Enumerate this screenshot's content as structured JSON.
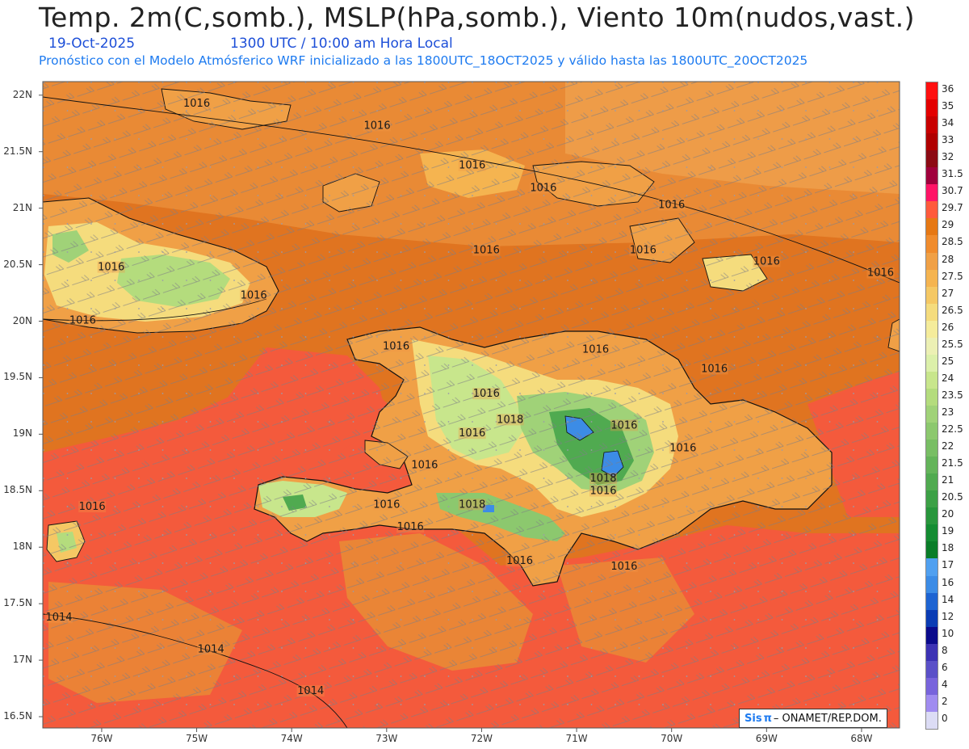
{
  "header": {
    "title": "Temp. 2m(C,somb.), MSLP(hPa,somb.), Viento 10m(nudos,vast.)",
    "date": "19-Oct-2025",
    "time": "1300 UTC / 10:00 am Hora Local",
    "model_info": "Pronóstico con el Modelo Atmósferico WRF inicializado a las 1800UTC_18OCT2025 y válido hasta las  1800UTC_20OCT2025"
  },
  "map": {
    "lat_labels": [
      "22N",
      "21.5N",
      "21N",
      "20.5N",
      "20N",
      "19.5N",
      "19N",
      "18.5N",
      "18N",
      "17.5N",
      "17N",
      "16.5N"
    ],
    "lon_labels": [
      "76W",
      "75W",
      "74W",
      "73W",
      "72W",
      "71W",
      "70W",
      "69W",
      "68W"
    ],
    "lat_values": [
      22,
      21.5,
      21,
      20.5,
      20,
      19.5,
      19,
      18.5,
      18,
      17.5,
      17,
      16.5
    ],
    "lon_values": [
      -76,
      -75,
      -74,
      -73,
      -72,
      -71,
      -70,
      -69,
      -68
    ],
    "isobars": [
      {
        "label": "1016",
        "lon": -75.0,
        "lat": 21.9
      },
      {
        "label": "1016",
        "lon": -73.1,
        "lat": 21.7
      },
      {
        "label": "1016",
        "lon": -72.1,
        "lat": 21.35
      },
      {
        "label": "1016",
        "lon": -71.35,
        "lat": 21.15
      },
      {
        "label": "1016",
        "lon": -70.0,
        "lat": 21.0
      },
      {
        "label": "1016",
        "lon": -70.3,
        "lat": 20.6
      },
      {
        "label": "1016",
        "lon": -71.95,
        "lat": 20.6
      },
      {
        "label": "1016",
        "lon": -69.0,
        "lat": 20.5
      },
      {
        "label": "1016",
        "lon": -67.8,
        "lat": 20.4
      },
      {
        "label": "1016",
        "lon": -75.9,
        "lat": 20.45
      },
      {
        "label": "1016",
        "lon": -74.4,
        "lat": 20.2
      },
      {
        "label": "1016",
        "lon": -76.2,
        "lat": 19.98
      },
      {
        "label": "1016",
        "lon": -72.9,
        "lat": 19.75
      },
      {
        "label": "1016",
        "lon": -70.8,
        "lat": 19.72
      },
      {
        "label": "1016",
        "lon": -69.55,
        "lat": 19.55
      },
      {
        "label": "1016",
        "lon": -71.95,
        "lat": 19.33
      },
      {
        "label": "1018",
        "lon": -71.7,
        "lat": 19.1
      },
      {
        "label": "1016",
        "lon": -72.1,
        "lat": 18.98
      },
      {
        "label": "1016",
        "lon": -70.5,
        "lat": 19.05
      },
      {
        "label": "1016",
        "lon": -69.88,
        "lat": 18.85
      },
      {
        "label": "1016",
        "lon": -72.6,
        "lat": 18.7
      },
      {
        "label": "1018",
        "lon": -70.72,
        "lat": 18.58
      },
      {
        "label": "1016",
        "lon": -70.72,
        "lat": 18.47
      },
      {
        "label": "1016",
        "lon": -76.1,
        "lat": 18.33
      },
      {
        "label": "1016",
        "lon": -73.0,
        "lat": 18.35
      },
      {
        "label": "1018",
        "lon": -72.1,
        "lat": 18.35
      },
      {
        "label": "1016",
        "lon": -72.75,
        "lat": 18.15
      },
      {
        "label": "1016",
        "lon": -71.6,
        "lat": 17.85
      },
      {
        "label": "1016",
        "lon": -70.5,
        "lat": 17.8
      },
      {
        "label": "1014",
        "lon": -76.45,
        "lat": 17.35
      },
      {
        "label": "1014",
        "lon": -74.85,
        "lat": 17.07
      },
      {
        "label": "1014",
        "lon": -73.8,
        "lat": 16.7
      }
    ]
  },
  "colorbar": {
    "labels": [
      "36",
      "35",
      "34",
      "33",
      "32",
      "31.5",
      "30.7",
      "29.7",
      "29",
      "28.5",
      "28",
      "27.5",
      "27",
      "26.5",
      "26",
      "25.5",
      "25",
      "24",
      "23.5",
      "23",
      "22.5",
      "22",
      "21.5",
      "21",
      "20.5",
      "20",
      "19",
      "18",
      "17",
      "16",
      "14",
      "12",
      "10",
      "8",
      "6",
      "4",
      "2",
      "0"
    ],
    "colors": [
      "#ff1010",
      "#e30000",
      "#c80000",
      "#b00000",
      "#8c0a14",
      "#a0003c",
      "#ff1466",
      "#ff5a3c",
      "#e67814",
      "#f08c2d",
      "#f0a046",
      "#f5b450",
      "#f5c864",
      "#f5dc7d",
      "#f5ec9b",
      "#ecf0b4",
      "#dcf0aa",
      "#c8e68c",
      "#b4dc7d",
      "#a0d278",
      "#8cc86e",
      "#78be64",
      "#64b45a",
      "#50aa50",
      "#3ca046",
      "#28963c",
      "#148c32",
      "#0a7d28",
      "#50a0f0",
      "#3c8ce6",
      "#1e64d2",
      "#0a3cb4",
      "#0a0a8c",
      "#3c32b4",
      "#5a50c8",
      "#7864dc",
      "#a08cf0",
      "#dcdcf5"
    ]
  },
  "brand": {
    "sis": "Sis",
    "pi": "π",
    "org": "– ONAMET/REP.DOM."
  }
}
